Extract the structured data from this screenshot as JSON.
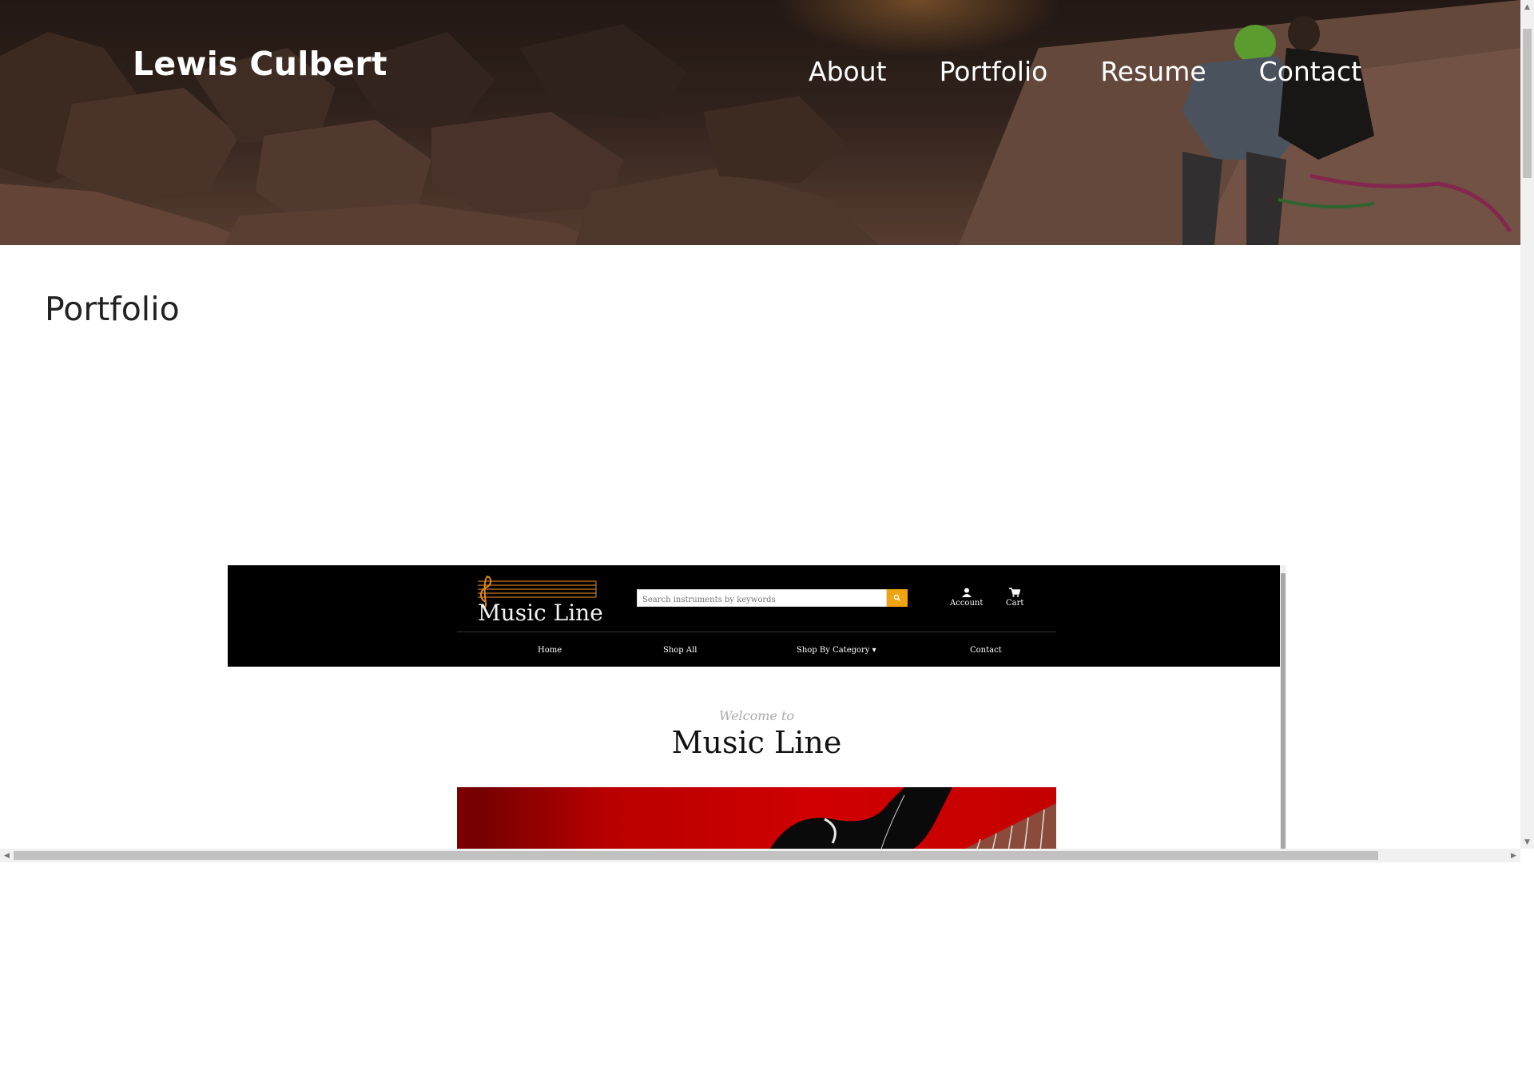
{
  "site": {
    "title": "Lewis Culbert",
    "nav": [
      {
        "label": "About"
      },
      {
        "label": "Portfolio"
      },
      {
        "label": "Resume"
      },
      {
        "label": "Contact"
      }
    ]
  },
  "main": {
    "section_title": "Portfolio"
  },
  "preview": {
    "logo_text": "Music Line",
    "search_placeholder": "Search instruments by keywords",
    "account_label": "Account",
    "cart_label": "Cart",
    "nav": [
      {
        "label": "Home"
      },
      {
        "label": "Shop All"
      },
      {
        "label": "Shop By Category ▾"
      },
      {
        "label": "Contact"
      }
    ],
    "welcome_small": "Welcome to",
    "welcome_big": "Music Line"
  },
  "colors": {
    "accent": "#f2a310",
    "header_bg": "#000000",
    "banner_red": "#d00000"
  },
  "icons": [
    "search-icon",
    "account-icon",
    "cart-icon",
    "treble-clef-icon",
    "scroll-left-icon",
    "scroll-right-icon",
    "scroll-up-icon",
    "scroll-down-icon"
  ]
}
